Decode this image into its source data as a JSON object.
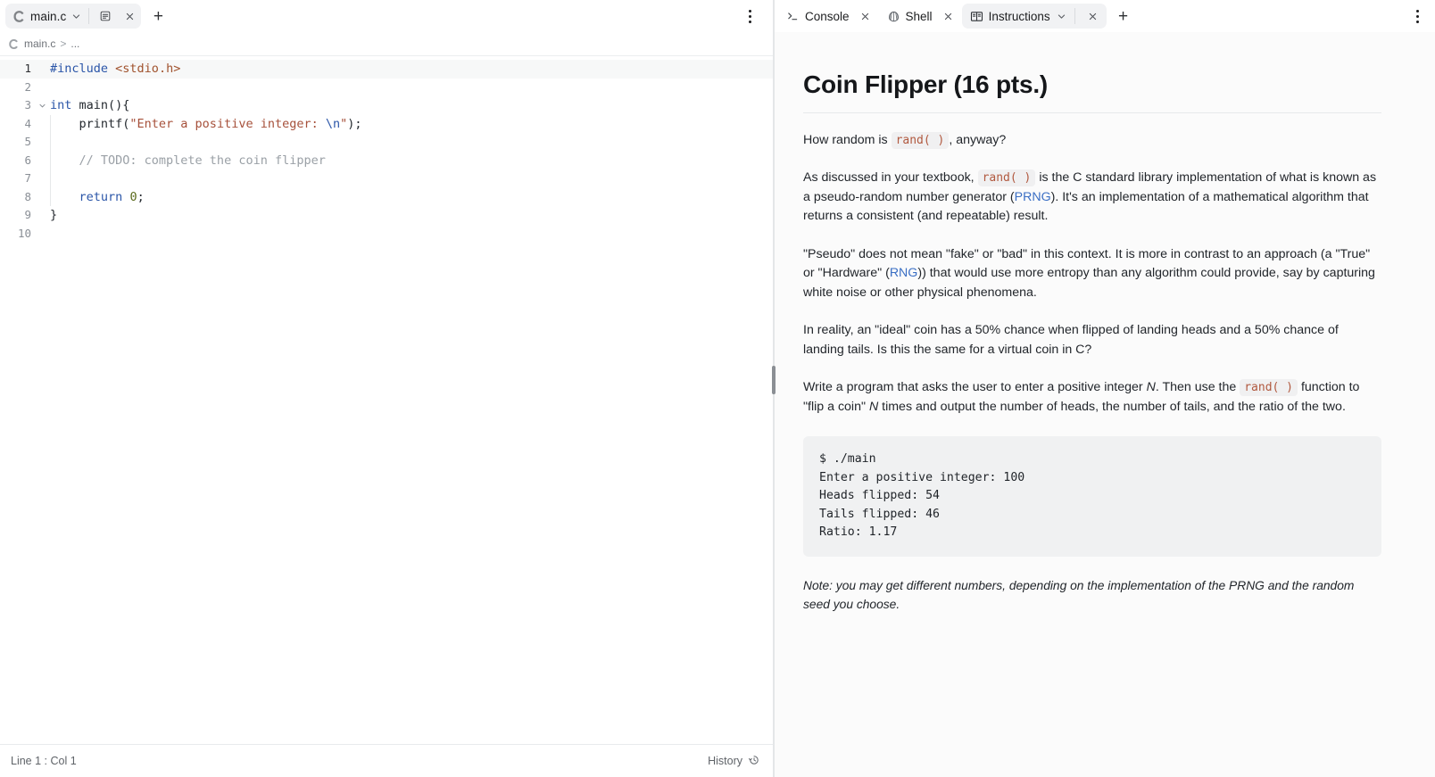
{
  "editor": {
    "tab": {
      "filename": "main.c",
      "file_icon": "c-language-icon",
      "chevron_icon": "chevron-down-icon",
      "preview_icon": "file-preview-icon",
      "close_icon": "close-icon"
    },
    "new_tab_label": "+",
    "kebab_icon": "more-options-icon",
    "breadcrumb": {
      "file_icon": "c-language-icon",
      "file": "main.c",
      "separator": ">",
      "ellipsis": "..."
    },
    "code": {
      "language": "c",
      "lines": [
        {
          "n": "1",
          "active": true,
          "fold": "",
          "tokens": [
            {
              "t": "#include",
              "c": "tk-pre"
            },
            {
              "t": " ",
              "c": "tk-plain"
            },
            {
              "t": "<stdio.h>",
              "c": "tk-hdr"
            }
          ]
        },
        {
          "n": "2",
          "active": false,
          "fold": "",
          "tokens": []
        },
        {
          "n": "3",
          "active": false,
          "fold": "v",
          "tokens": [
            {
              "t": "int",
              "c": "tk-kw"
            },
            {
              "t": " ",
              "c": "tk-plain"
            },
            {
              "t": "main",
              "c": "tk-fn"
            },
            {
              "t": "(){",
              "c": "tk-plain"
            }
          ]
        },
        {
          "n": "4",
          "active": false,
          "fold": "",
          "indent": 1,
          "tokens": [
            {
              "t": "    printf(",
              "c": "tk-plain"
            },
            {
              "t": "\"Enter a positive integer: ",
              "c": "tk-str"
            },
            {
              "t": "\\n",
              "c": "tk-esc"
            },
            {
              "t": "\"",
              "c": "tk-str"
            },
            {
              "t": ");",
              "c": "tk-plain"
            }
          ]
        },
        {
          "n": "5",
          "active": false,
          "fold": "",
          "indent": 1,
          "tokens": []
        },
        {
          "n": "6",
          "active": false,
          "fold": "",
          "indent": 1,
          "tokens": [
            {
              "t": "    // TODO: complete the coin flipper",
              "c": "tk-cmt"
            }
          ]
        },
        {
          "n": "7",
          "active": false,
          "fold": "",
          "indent": 1,
          "tokens": []
        },
        {
          "n": "8",
          "active": false,
          "fold": "",
          "indent": 1,
          "tokens": [
            {
              "t": "    ",
              "c": "tk-plain"
            },
            {
              "t": "return",
              "c": "tk-kw"
            },
            {
              "t": " ",
              "c": "tk-plain"
            },
            {
              "t": "0",
              "c": "tk-num"
            },
            {
              "t": ";",
              "c": "tk-plain"
            }
          ]
        },
        {
          "n": "9",
          "active": false,
          "fold": "",
          "tokens": [
            {
              "t": "}",
              "c": "tk-plain"
            }
          ]
        },
        {
          "n": "10",
          "active": false,
          "fold": "",
          "tokens": []
        }
      ]
    },
    "status": {
      "cursor": "Line 1 : Col 1",
      "history_label": "History",
      "history_icon": "history-clock-icon"
    }
  },
  "right_panel": {
    "tabs": [
      {
        "label": "Console",
        "icon": "terminal-prompt-icon",
        "active": false,
        "has_chevron": false,
        "close_icon": "close-icon"
      },
      {
        "label": "Shell",
        "icon": "shell-icon",
        "active": false,
        "has_chevron": false,
        "close_icon": "close-icon"
      },
      {
        "label": "Instructions",
        "icon": "book-open-icon",
        "active": true,
        "has_chevron": true,
        "chevron_icon": "chevron-down-icon",
        "close_icon": "close-icon"
      }
    ],
    "new_tab_label": "+",
    "kebab_icon": "more-options-icon"
  },
  "instructions": {
    "title": "Coin Flipper (16 pts.)",
    "p1": {
      "a": "How random is ",
      "code": "rand( )",
      "b": ", anyway?"
    },
    "p2": {
      "a": "As discussed in your textbook, ",
      "code": "rand( )",
      "b": " is the C standard library implementation of what is known as a pseudo-random number generator (",
      "link": "PRNG",
      "c": "). It's an implementation of a mathematical algorithm that returns a consistent (and repeatable) result."
    },
    "p3": {
      "a": "\"Pseudo\" does not mean \"fake\" or \"bad\" in this context. It is more in contrast to an approach (a \"True\" or \"Hardware\" (",
      "link": "RNG",
      "b": ")) that would use more entropy than any algorithm could provide, say by capturing white noise or other physical phenomena."
    },
    "p4": "In reality, an \"ideal\" coin has a 50% chance when flipped of landing heads and a 50% chance of landing tails. Is this the same for a virtual coin in C?",
    "p5": {
      "a": "Write a program that asks the user to enter a positive integer ",
      "var1": "N",
      "b": ". Then use the ",
      "code": "rand( )",
      "c": " function to \"flip a coin\" ",
      "var2": "N",
      "d": " times and output the number of heads, the number of tails, and the ratio of the two."
    },
    "sample_output": "$ ./main\nEnter a positive integer: 100\nHeads flipped: 54\nTails flipped: 46\nRatio: 1.17",
    "note": "Note: you may get different numbers, depending on the implementation of the PRNG and the random seed you choose."
  },
  "colors": {
    "accent_link": "#3b6fc4",
    "inline_code_text": "#b1593f",
    "inline_code_bg": "#f0f0f1",
    "tab_active_bg": "#f1f2f4",
    "panel_bg": "#fbfbfb",
    "code_bg": "#f0f1f2"
  }
}
